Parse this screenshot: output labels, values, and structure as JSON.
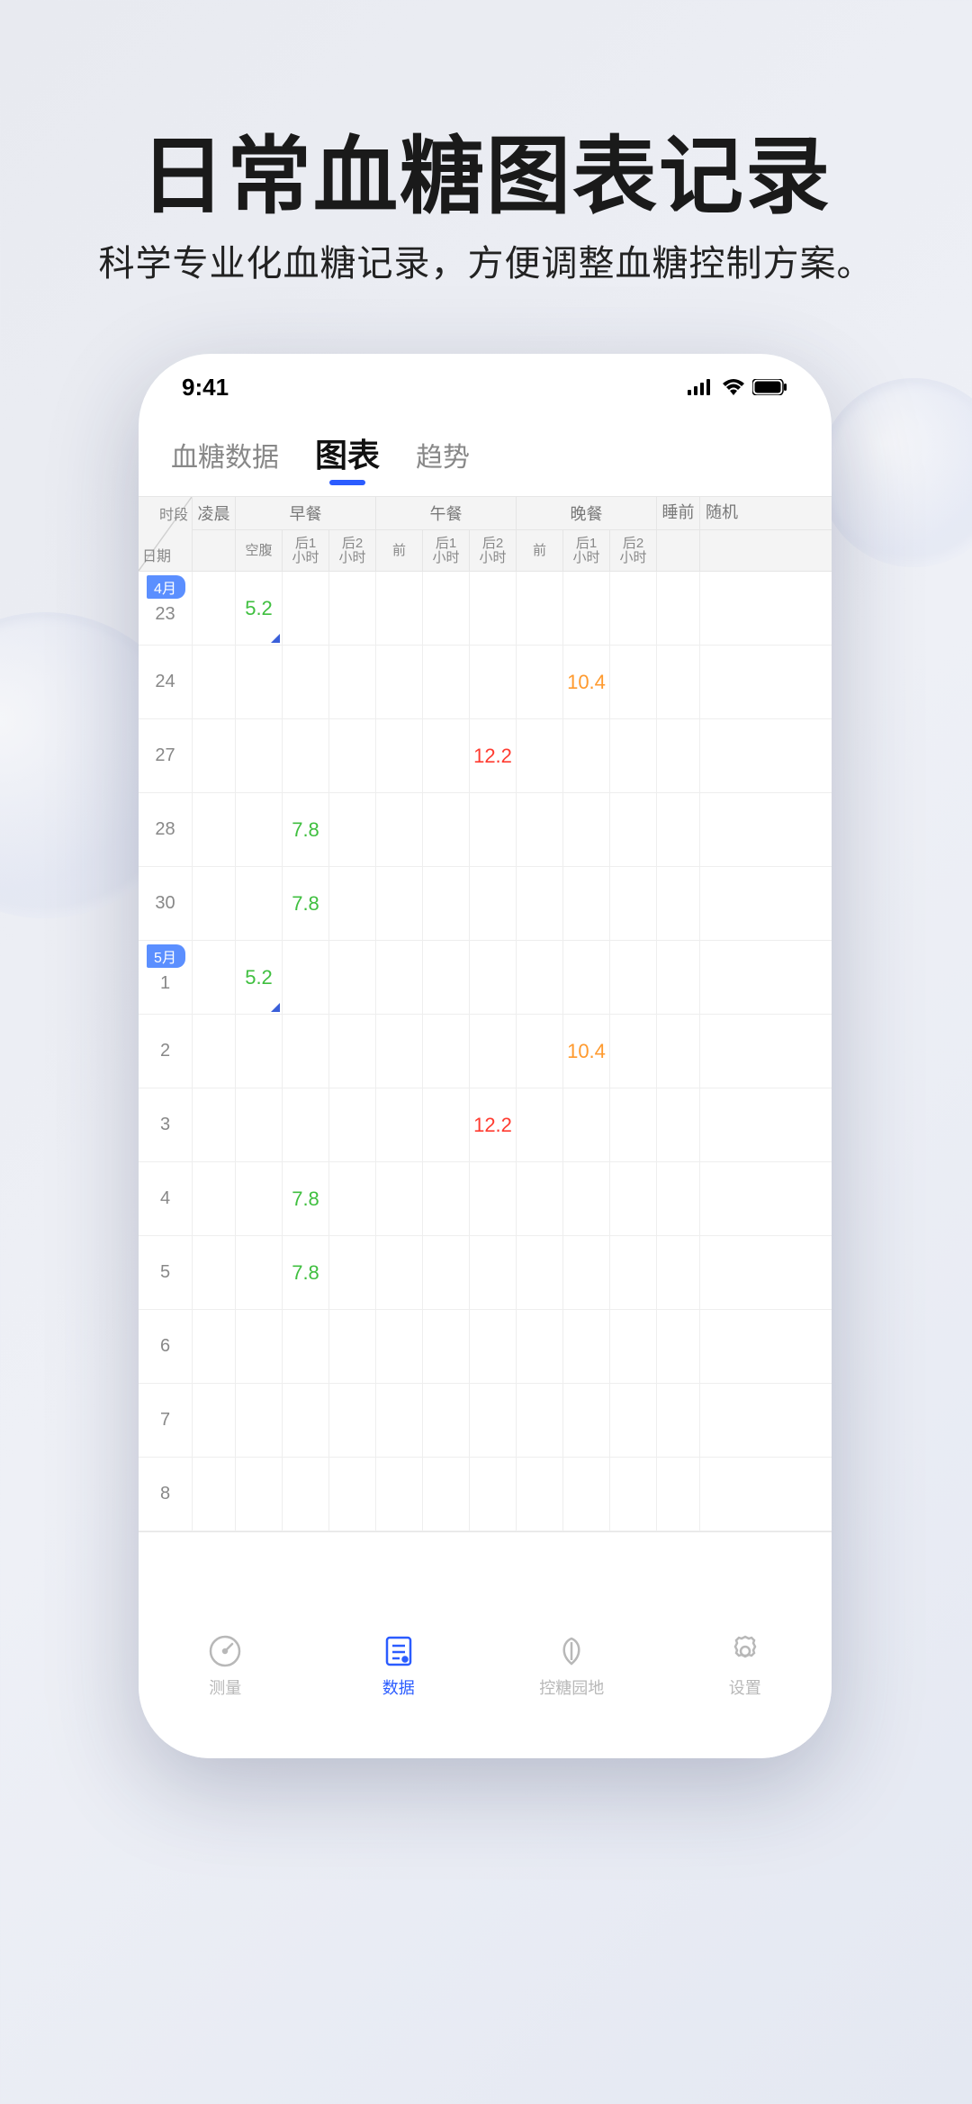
{
  "promo": {
    "title": "日常血糖图表记录",
    "subtitle": "科学专业化血糖记录，方便调整血糖控制方案。"
  },
  "status": {
    "time": "9:41"
  },
  "tabs": {
    "seg": [
      "血糖数据",
      "图表",
      "趋势"
    ],
    "activeIndex": 1
  },
  "table": {
    "corner": {
      "top": "时段",
      "bottom": "日期"
    },
    "groups": {
      "lingchen": "凌晨",
      "zaocan": "早餐",
      "wucan": "午餐",
      "wancan": "晚餐",
      "shuiqian": "睡前",
      "suiji": "随机"
    },
    "subs": {
      "kongfu": "空腹",
      "hou1": "后1小时",
      "hou2": "后2小时",
      "qian": "前"
    },
    "months": {
      "m4": "4月",
      "m5": "5月"
    },
    "rows": [
      {
        "month": "m4",
        "day": "23",
        "cells": {
          "zc_kf": {
            "v": "5.2",
            "cls": "val-green",
            "note": true
          }
        }
      },
      {
        "day": "24",
        "cells": {
          "wan_h1": {
            "v": "10.4",
            "cls": "val-orange"
          }
        }
      },
      {
        "day": "27",
        "cells": {
          "wc_h2": {
            "v": "12.2",
            "cls": "val-red"
          }
        }
      },
      {
        "day": "28",
        "cells": {
          "zc_h1": {
            "v": "7.8",
            "cls": "val-green"
          }
        }
      },
      {
        "day": "30",
        "cells": {
          "zc_h1": {
            "v": "7.8",
            "cls": "val-green"
          }
        }
      },
      {
        "month": "m5",
        "day": "1",
        "cells": {
          "zc_kf": {
            "v": "5.2",
            "cls": "val-green",
            "note": true
          }
        }
      },
      {
        "day": "2",
        "cells": {
          "wan_h1": {
            "v": "10.4",
            "cls": "val-orange"
          }
        }
      },
      {
        "day": "3",
        "cells": {
          "wc_h2": {
            "v": "12.2",
            "cls": "val-red"
          }
        }
      },
      {
        "day": "4",
        "cells": {
          "zc_h1": {
            "v": "7.8",
            "cls": "val-green"
          }
        }
      },
      {
        "day": "5",
        "cells": {
          "zc_h1": {
            "v": "7.8",
            "cls": "val-green"
          }
        }
      },
      {
        "day": "6",
        "cells": {}
      },
      {
        "day": "7",
        "cells": {}
      },
      {
        "day": "8",
        "cells": {}
      }
    ]
  },
  "tabbar": {
    "items": [
      {
        "label": "测量",
        "icon": "gauge"
      },
      {
        "label": "数据",
        "icon": "data"
      },
      {
        "label": "控糖园地",
        "icon": "leaf"
      },
      {
        "label": "设置",
        "icon": "gear"
      }
    ],
    "activeIndex": 1
  }
}
